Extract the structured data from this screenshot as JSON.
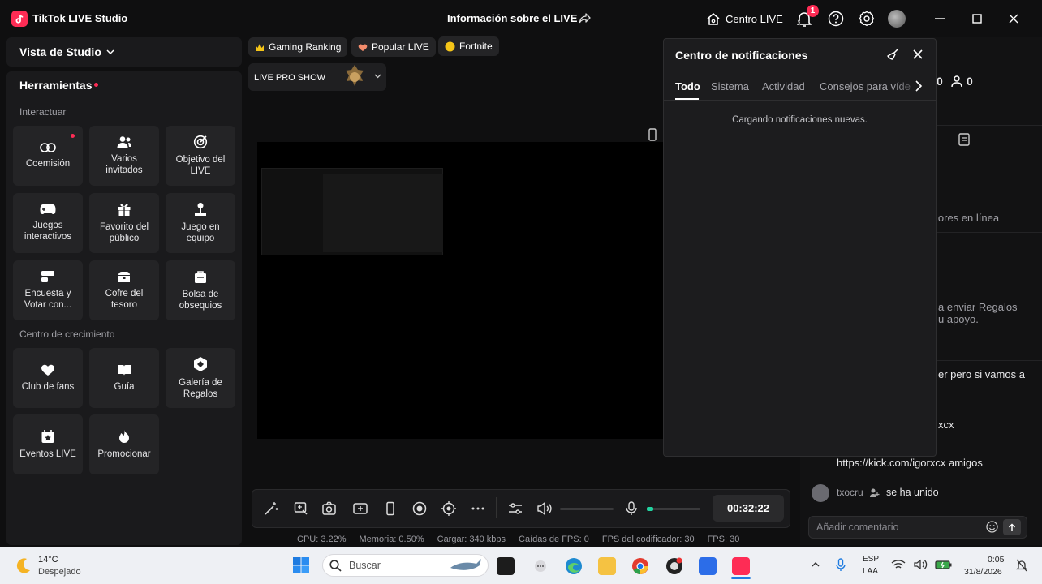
{
  "titlebar": {
    "app_title": "TikTok LIVE Studio",
    "live_info": "Información sobre el LIVE",
    "centro_live": "Centro LIVE",
    "notification_count": "1"
  },
  "sidebar": {
    "studio_view": "Vista de Studio",
    "tools_title": "Herramientas",
    "sections": {
      "interact": "Interactuar",
      "growth": "Centro de crecimiento"
    },
    "interact_tools": [
      {
        "label": "Coemisión",
        "icon": "link-icon"
      },
      {
        "label": "Varios invitados",
        "icon": "guests-icon"
      },
      {
        "label": "Objetivo del LIVE",
        "icon": "target-icon"
      },
      {
        "label": "Juegos interactivos",
        "icon": "gamepad-icon"
      },
      {
        "label": "Favorito del público",
        "icon": "gift-icon"
      },
      {
        "label": "Juego en equipo",
        "icon": "joystick-icon"
      },
      {
        "label": "Encuesta y Votar con...",
        "icon": "poll-icon"
      },
      {
        "label": "Cofre del tesoro",
        "icon": "chest-icon"
      },
      {
        "label": "Bolsa de obsequios",
        "icon": "bag-icon"
      }
    ],
    "growth_tools": [
      {
        "label": "Club de fans",
        "icon": "heart-icon"
      },
      {
        "label": "Guía",
        "icon": "book-icon"
      },
      {
        "label": "Galería de Regalos",
        "icon": "gallery-icon"
      },
      {
        "label": "Eventos LIVE",
        "icon": "calendar-icon"
      },
      {
        "label": "Promocionar",
        "icon": "flame-icon"
      }
    ]
  },
  "center": {
    "tags": [
      "Gaming Ranking",
      "Popular LIVE",
      "Fortnite"
    ],
    "source_label": "LIVE PRO SHOW",
    "timer": "00:32:22",
    "stats": {
      "cpu": "CPU: 3.22%",
      "memory": "Memoria: 0.50%",
      "load": "Cargar: 340 kbps",
      "fps_drops": "Caídas de FPS: 0",
      "encoder_fps": "FPS del codificador: 30",
      "fps": "FPS: 30"
    },
    "mic_level": 0.12
  },
  "right_panel": {
    "counter_a": "0",
    "counter_b": "0",
    "online_text": "lores en línea",
    "gifts_text_1": "a enviar Regalos",
    "gifts_text_2": "u apoyo.",
    "chat_line_1": "er pero si vamos a",
    "chat_line_2": "xcx",
    "chat_line_3": "https://kick.com/igorxcx amigos",
    "joined_user": "txocru",
    "joined_text": "se ha unido",
    "comment_placeholder": "Añadir comentario"
  },
  "notifications": {
    "title": "Centro de notificaciones",
    "tabs": [
      "Todo",
      "Sistema",
      "Actividad",
      "Consejos para víde"
    ],
    "active_tab": "Todo",
    "loading": "Cargando notificaciones nuevas."
  },
  "taskbar": {
    "weather_temp": "14°C",
    "weather_desc": "Despejado",
    "search": "Buscar",
    "lang_1": "ESP",
    "lang_2": "LAA",
    "time": "0:05",
    "date": "31/8/2026"
  },
  "colors": {
    "accent": "#fe2c55",
    "mic_level": "#22d3a0"
  }
}
